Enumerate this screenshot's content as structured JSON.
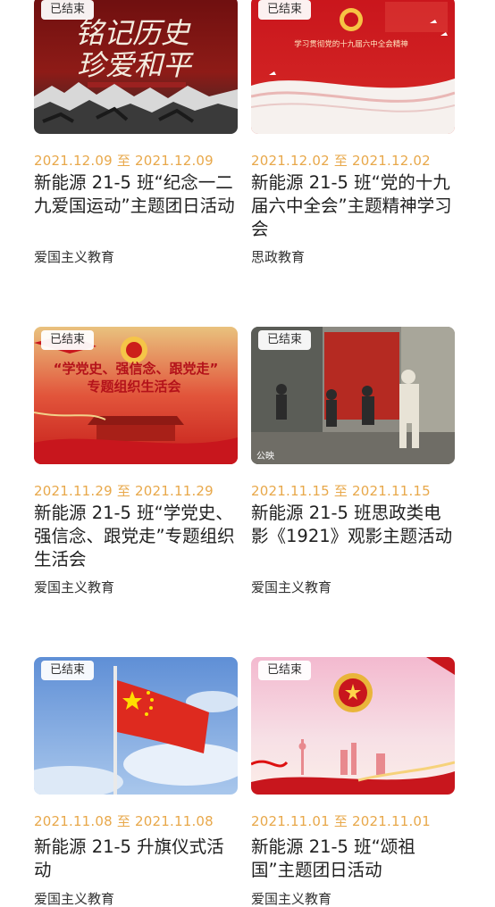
{
  "cards": [
    {
      "badge": "已结束",
      "start": "2021.12.09",
      "sep": "至",
      "end": "2021.12.09",
      "title": "新能源 21-5 班“纪念一二九爱国运动”主题团日活动",
      "category": "爱国主义教育",
      "poster": {
        "line1": "铭记历史",
        "line2": "珍爱和平"
      }
    },
    {
      "badge": "已结束",
      "start": "2021.12.02",
      "sep": "至",
      "end": "2021.12.02",
      "title": "新能源 21-5 班“党的十九届六中全会”主题精神学习会",
      "category": "思政教育",
      "poster": {
        "line1": "学习贯彻党的十九届六中全会精神"
      }
    },
    {
      "badge": "已结束",
      "start": "2021.11.29",
      "sep": "至",
      "end": "2021.11.29",
      "title": "新能源 21-5 班“学党史、强信念、跟党走”专题组织生活会",
      "category": "爱国主义教育",
      "poster": {
        "line1": "“学党史、强信念、跟党走”",
        "line2": "专题组织生活会"
      }
    },
    {
      "badge": "已结束",
      "start": "2021.11.15",
      "sep": "至",
      "end": "2021.11.15",
      "title": "新能源 21-5 班思政类电影《1921》观影主题活动",
      "category": "爱国主义教育",
      "poster": {
        "line1": "公映"
      }
    },
    {
      "badge": "已结束",
      "start": "2021.11.08",
      "sep": "至",
      "end": "2021.11.08",
      "title": "新能源 21-5 升旗仪式活动",
      "category": "爱国主义教育"
    },
    {
      "badge": "已结束",
      "start": "2021.11.01",
      "sep": "至",
      "end": "2021.11.01",
      "title": "新能源 21-5 班“颂祖国”主题团日活动",
      "category": "爱国主义教育"
    }
  ],
  "colors": {
    "date": "#e8a84a",
    "title": "#1f1f1f",
    "category": "#333333",
    "party_red": "#c8161d"
  }
}
